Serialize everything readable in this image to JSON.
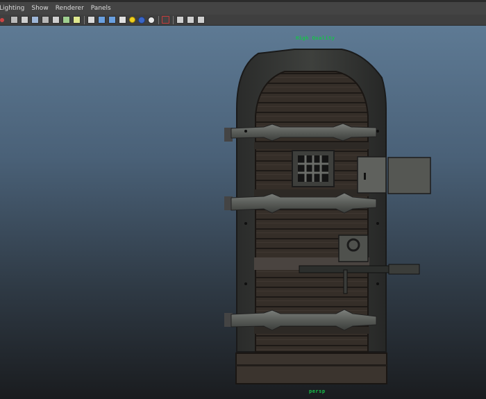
{
  "menubar": {
    "items": [
      "Lighting",
      "Show",
      "Renderer",
      "Panels"
    ]
  },
  "toolbar": {
    "icons": [
      "camera-select-icon",
      "bookmark-icon",
      "grid-icon",
      "wireframe-icon",
      "smooth-shade-icon",
      "shade-all-icon",
      "wireframe-on-shaded-icon",
      "textured-icon",
      "use-all-lights-icon",
      "shadows-icon",
      "isolate-select-icon",
      "xray-icon",
      "xray-joints-icon",
      "use-default-material-icon",
      "default-lighting-icon",
      "ambient-occlusion-icon",
      "motion-blur-icon",
      "high-quality-icon",
      "frame-all-icon",
      "frame-selection-icon",
      "sync-icon"
    ]
  },
  "viewport": {
    "hud_top": "High Quality",
    "hud_bottom": "persp",
    "colors": {
      "background_top": "#5e7a94",
      "background_bottom": "#1a1c1f",
      "hud_text": "#16c24a"
    }
  }
}
